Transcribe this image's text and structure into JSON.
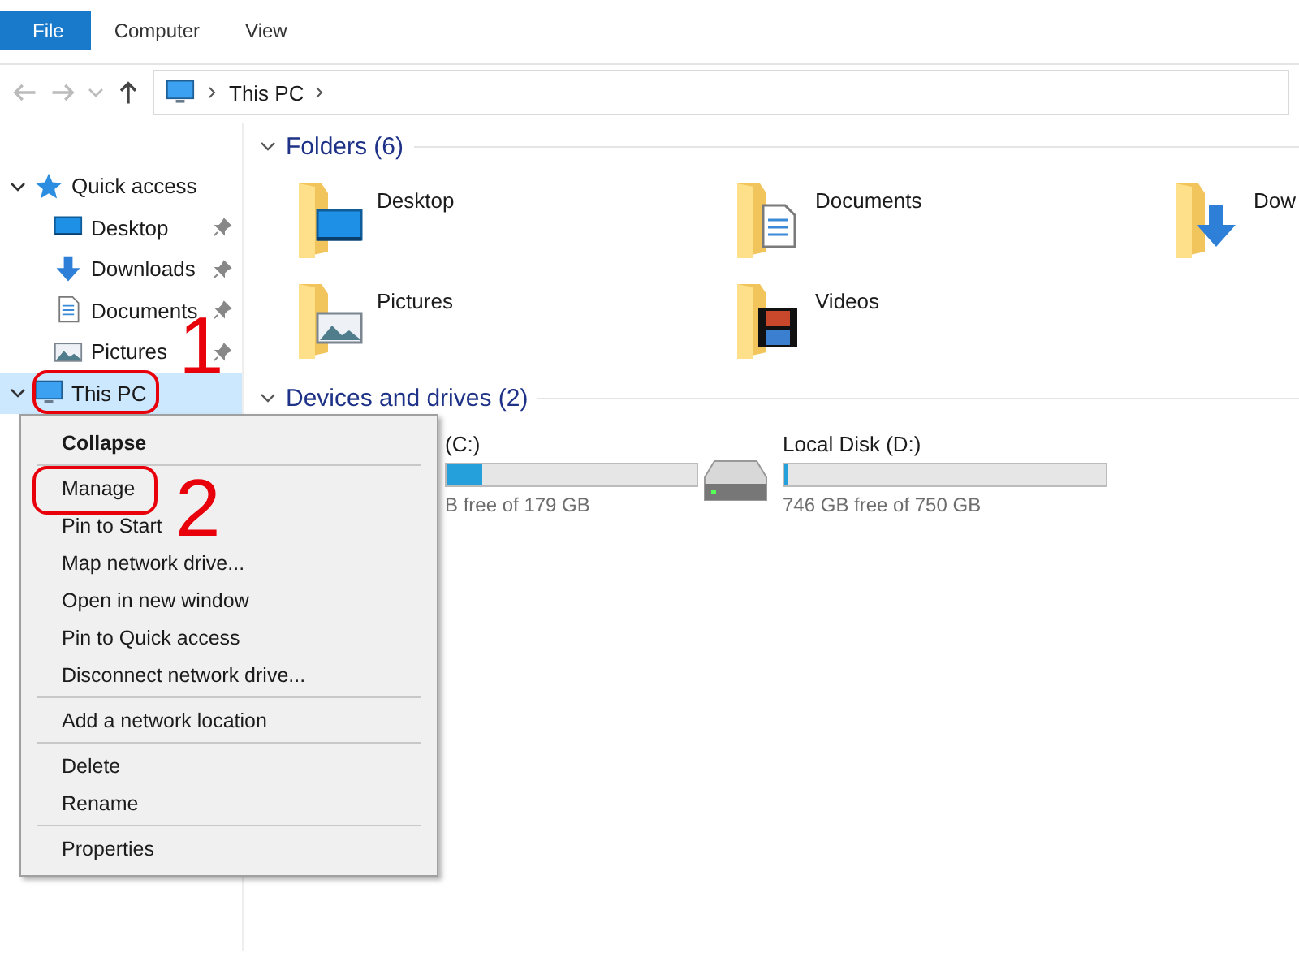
{
  "ribbon": {
    "tabs": [
      {
        "label": "File",
        "kind": "file",
        "selected": false
      },
      {
        "label": "Computer",
        "kind": "tab",
        "selected": false
      },
      {
        "label": "View",
        "kind": "tab",
        "selected": false
      }
    ]
  },
  "address_bar": {
    "path": [
      "This PC"
    ]
  },
  "navigation_pane": {
    "items": [
      {
        "label": "Quick access",
        "kind": "star",
        "expanded": true,
        "selected": false,
        "children": [
          {
            "label": "Desktop",
            "kind": "desktop",
            "pinned": true,
            "selected": false
          },
          {
            "label": "Downloads",
            "kind": "downloads",
            "pinned": true,
            "selected": false
          },
          {
            "label": "Documents",
            "kind": "documents",
            "pinned": true,
            "selected": false
          },
          {
            "label": "Pictures",
            "kind": "pictures",
            "pinned": true,
            "selected": false
          }
        ]
      },
      {
        "label": "This PC",
        "kind": "pc",
        "expanded": true,
        "selected": true
      }
    ]
  },
  "content": {
    "groups": [
      {
        "title": "Folders (6)",
        "kind": "folders",
        "items": [
          {
            "label": "Desktop",
            "kind": "desktop"
          },
          {
            "label": "Documents",
            "kind": "documents"
          },
          {
            "label": "Dow",
            "kind": "downloads"
          },
          {
            "label": "Pictures",
            "kind": "pictures"
          },
          {
            "label": "Videos",
            "kind": "videos"
          }
        ]
      },
      {
        "title": "Devices and drives (2)",
        "kind": "drives",
        "items": [
          {
            "label": "(C:)",
            "free": "B free of 179 GB",
            "level": 0.14,
            "kind": "hidden"
          },
          {
            "label": "Local Disk (D:)",
            "free": "746 GB free of 750 GB",
            "level": 0.01,
            "kind": "disk"
          }
        ]
      }
    ]
  },
  "context_menu": {
    "sections": [
      [
        {
          "label": "Collapse",
          "default": true
        }
      ],
      [
        {
          "label": "Manage",
          "default": false
        },
        {
          "label": "Pin to Start",
          "default": false
        },
        {
          "label": "Map network drive...",
          "default": false
        },
        {
          "label": "Open in new window",
          "default": false
        },
        {
          "label": "Pin to Quick access",
          "default": false
        },
        {
          "label": "Disconnect network drive...",
          "default": false
        }
      ],
      [
        {
          "label": "Add a network location",
          "default": false
        }
      ],
      [
        {
          "label": "Delete",
          "default": false
        },
        {
          "label": "Rename",
          "default": false
        }
      ],
      [
        {
          "label": "Properties",
          "default": false
        }
      ]
    ]
  },
  "annotations": [
    {
      "label": "1",
      "kind": "step"
    },
    {
      "label": "2",
      "kind": "step"
    }
  ]
}
